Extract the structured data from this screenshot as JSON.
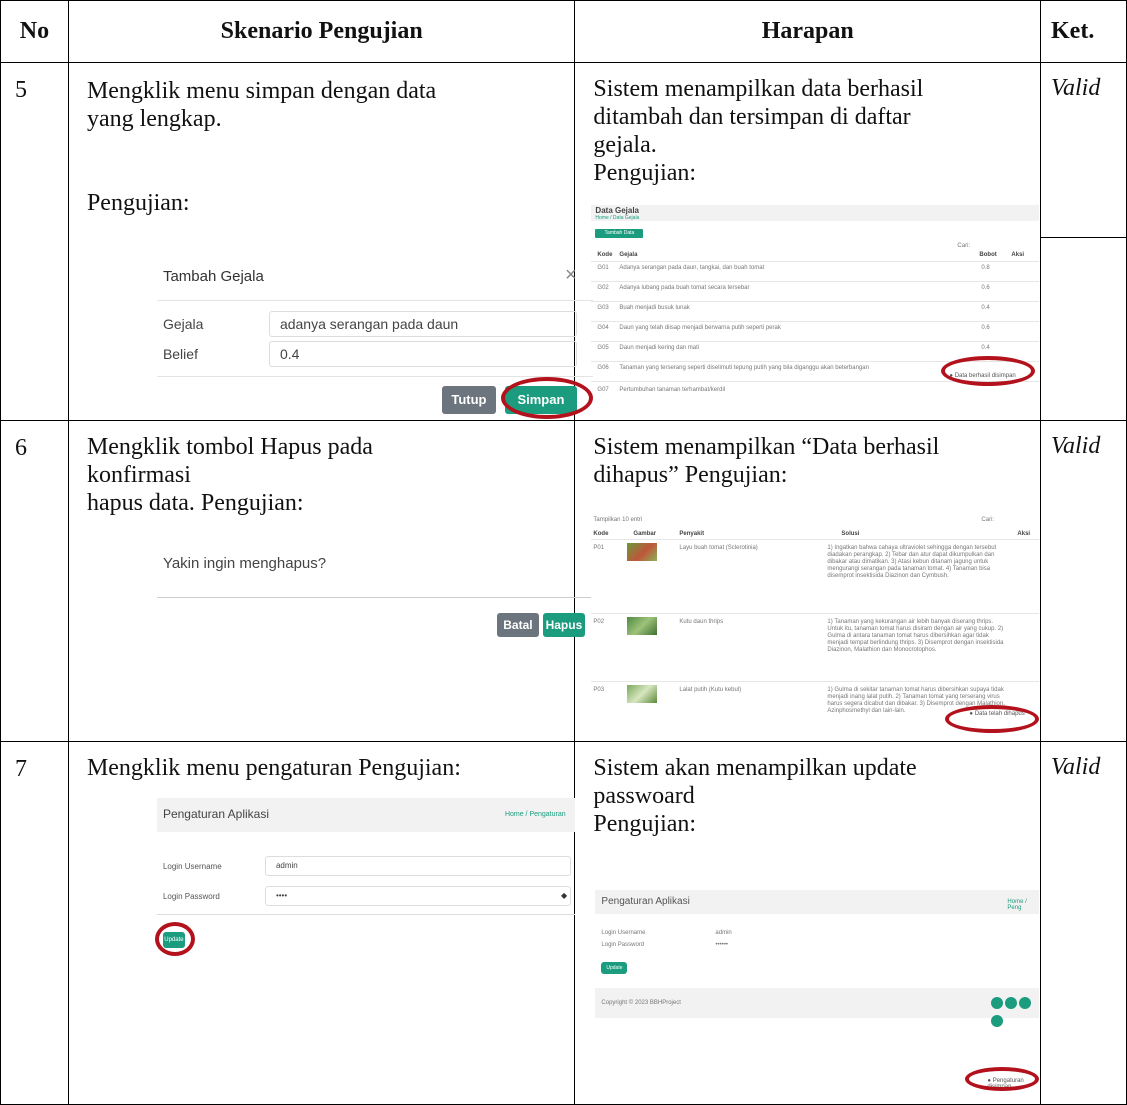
{
  "headers": {
    "no": "No",
    "skenario": "Skenario Pengujian",
    "harapan": "Harapan",
    "ket": "Ket."
  },
  "rows": [
    {
      "no": "5",
      "skenario_line1": "Mengklik menu simpan dengan data",
      "skenario_line2": "yang lengkap.",
      "skenario_pengujian": "Pengujian:",
      "harapan_line1": "Sistem menampilkan data berhasil",
      "harapan_line2": "ditambah dan tersimpan di daftar",
      "harapan_line3": "gejala.",
      "harapan_pengujian": "Pengujian:",
      "ket": "Valid",
      "modal": {
        "title": "Tambah Gejala",
        "gejala_label": "Gejala",
        "gejala_value": "adanya serangan pada daun",
        "belief_label": "Belief",
        "belief_value": "0.4",
        "close_button": "Tutup",
        "save_button": "Simpan"
      },
      "shot": {
        "title": "Data Gejala",
        "breadcrumb": "Home / Data Gejala",
        "add_button": "Tambah Data",
        "search_label": "Cari:",
        "col_kode": "Kode",
        "col_gejala": "Gejala",
        "col_bobot": "Bobot",
        "col_aksi": "Aksi",
        "rows": [
          {
            "kode": "G01",
            "gejala": "Adanya serangan pada daun, tangkai, dan buah tomat",
            "bobot": "0.8"
          },
          {
            "kode": "G02",
            "gejala": "Adanya lubang pada buah tomat secara tersebar",
            "bobot": "0.6"
          },
          {
            "kode": "G03",
            "gejala": "Buah menjadi busuk lunak",
            "bobot": "0.4"
          },
          {
            "kode": "G04",
            "gejala": "Daun yang telah diisap menjadi berwarna putih seperti perak",
            "bobot": "0.6"
          },
          {
            "kode": "G05",
            "gejala": "Daun menjadi kering dan mati",
            "bobot": "0.4"
          },
          {
            "kode": "G06",
            "gejala": "Tanaman yang terserang seperti diselimuti tepung putih yang bila diganggu akan beterbangan",
            "bobot": ""
          },
          {
            "kode": "G07",
            "gejala": "Pertumbuhan tanaman terhambat/kerdil",
            "bobot": ""
          }
        ],
        "toast": "Data berhasil disimpan"
      }
    },
    {
      "no": "6",
      "skenario_line1": "Mengklik tombol Hapus pada",
      "skenario_line2": "konfirmasi",
      "skenario_line3": "hapus data. Pengujian:",
      "harapan_line1": "Sistem menampilkan “Data berhasil",
      "harapan_line2": "dihapus” Pengujian:",
      "ket": "Valid",
      "confirm": {
        "question": "Yakin ingin menghapus?",
        "cancel_button": "Batal",
        "delete_button": "Hapus"
      },
      "shot": {
        "show_label": "Tampilkan 10 entri",
        "search_label": "Cari:",
        "col_kode": "Kode",
        "col_gambar": "Gambar",
        "col_penyakit": "Penyakit",
        "col_solusi": "Solusi",
        "col_aksi": "Aksi",
        "rows": [
          {
            "kode": "P01",
            "penyakit": "Layu buah tomat (Sclerotinia)",
            "solusi": "1) Ingatkan bahwa cahaya ultraviolet sehingga dengan tersebut diadakan perangkap. 2) Tebar dan atur dapat dikumpulkan dan dibakar atau dimatikan. 3) Atasi kebun ditanam jagung untuk mengurangi serangan pada tanaman tomat. 4) Tanaman bisa disemprot insektisida Diazinon dan Cymbush."
          },
          {
            "kode": "P02",
            "penyakit": "Kutu daun thrips",
            "solusi": "1) Tanaman yang kekurangan air lebih banyak diserang thrips. Untuk itu, tanaman tomat harus disiram dengan air yang cukup. 2) Gulma di antara tanaman tomat harus dibersihkan agar tidak menjadi tempat berlindung thrips. 3) Disemprot dengan insektisida Diazinon, Malathion dan Monocrotophos."
          },
          {
            "kode": "P03",
            "penyakit": "Lalat putih (Kutu kebul)",
            "solusi": "1) Gulma di sekitar tanaman tomat harus dibersihkan supaya tidak menjadi inang lalat putih. 2) Tanaman tomat yang terserang virus harus segera dicabut dan dibakar. 3) Disemprot dengan Malathion, Azinphosmethyl dan lain-lain."
          }
        ],
        "toast": "Data telah dihapus"
      }
    },
    {
      "no": "7",
      "skenario_line1": "Mengklik menu pengaturan Pengujian:",
      "harapan_line1": "Sistem akan menampilkan update",
      "harapan_line2": "passwoard",
      "harapan_pengujian": "Pengujian:",
      "ket": "Valid",
      "settings": {
        "title": "Pengaturan Aplikasi",
        "breadcrumb": "Home / Pengaturan",
        "username_label": "Login Username",
        "username_value": "admin",
        "password_label": "Login Password",
        "password_value": "••••",
        "update_button": "Update"
      },
      "shot": {
        "title": "Pengaturan Aplikasi",
        "breadcrumb": "Home / Peng",
        "username_label": "Login Username",
        "username_value": "admin",
        "password_label": "Login Password",
        "password_value": "••••••",
        "update_button": "Update",
        "copyright": "Copyright © 2023 BBHProject",
        "toast": "Pengaturan disimpan"
      }
    }
  ]
}
